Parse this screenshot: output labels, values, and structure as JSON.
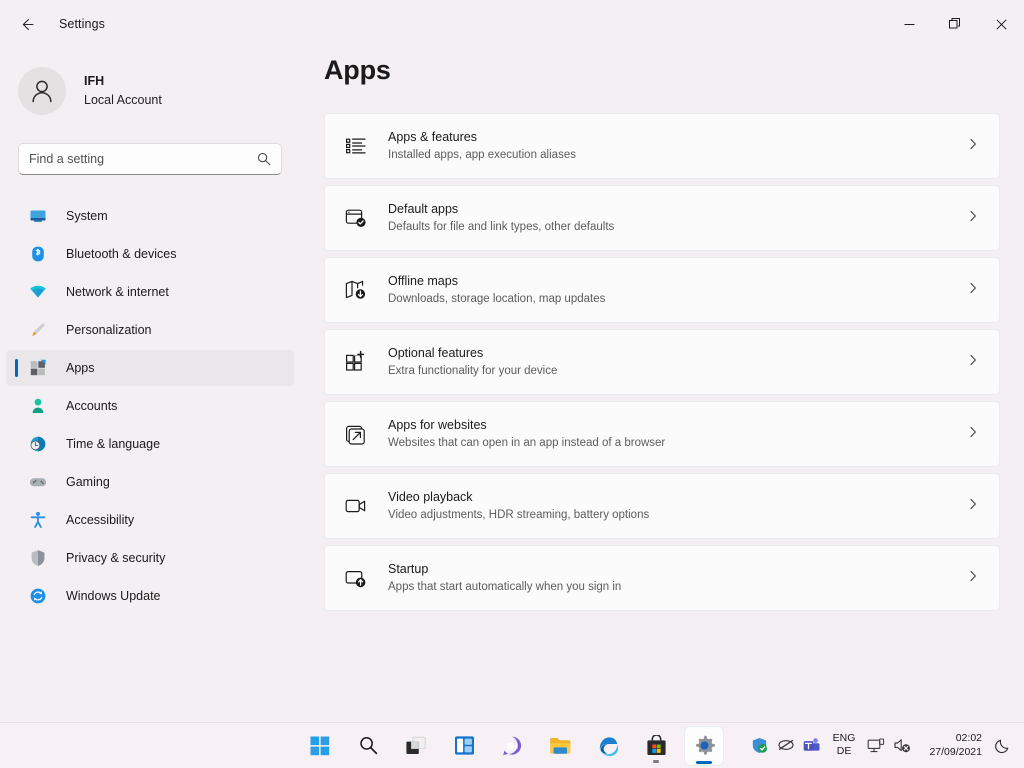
{
  "window": {
    "title": "Settings",
    "back_label": "back-arrow",
    "minimize_label": "Minimize",
    "maximize_label": "Restore",
    "close_label": "Close"
  },
  "account": {
    "name": "IFH",
    "type": "Local Account"
  },
  "search": {
    "placeholder": "Find a setting",
    "value": ""
  },
  "sidebar": {
    "items": [
      {
        "label": "System",
        "icon": "system-icon",
        "selected": false
      },
      {
        "label": "Bluetooth & devices",
        "icon": "bluetooth-icon",
        "selected": false
      },
      {
        "label": "Network & internet",
        "icon": "network-icon",
        "selected": false
      },
      {
        "label": "Personalization",
        "icon": "personalization-icon",
        "selected": false
      },
      {
        "label": "Apps",
        "icon": "apps-icon",
        "selected": true
      },
      {
        "label": "Accounts",
        "icon": "accounts-icon",
        "selected": false
      },
      {
        "label": "Time & language",
        "icon": "time-language-icon",
        "selected": false
      },
      {
        "label": "Gaming",
        "icon": "gaming-icon",
        "selected": false
      },
      {
        "label": "Accessibility",
        "icon": "accessibility-icon",
        "selected": false
      },
      {
        "label": "Privacy & security",
        "icon": "privacy-security-icon",
        "selected": false
      },
      {
        "label": "Windows Update",
        "icon": "windows-update-icon",
        "selected": false
      }
    ]
  },
  "main": {
    "title": "Apps",
    "cards": [
      {
        "title": "Apps & features",
        "subtitle": "Installed apps, app execution aliases",
        "icon": "apps-features-icon"
      },
      {
        "title": "Default apps",
        "subtitle": "Defaults for file and link types, other defaults",
        "icon": "default-apps-icon"
      },
      {
        "title": "Offline maps",
        "subtitle": "Downloads, storage location, map updates",
        "icon": "offline-maps-icon"
      },
      {
        "title": "Optional features",
        "subtitle": "Extra functionality for your device",
        "icon": "optional-features-icon"
      },
      {
        "title": "Apps for websites",
        "subtitle": "Websites that can open in an app instead of a browser",
        "icon": "apps-for-websites-icon"
      },
      {
        "title": "Video playback",
        "subtitle": "Video adjustments, HDR streaming, battery options",
        "icon": "video-playback-icon"
      },
      {
        "title": "Startup",
        "subtitle": "Apps that start automatically when you sign in",
        "icon": "startup-icon"
      }
    ]
  },
  "taskbar": {
    "buttons": [
      {
        "name": "start-button",
        "label": "Start"
      },
      {
        "name": "search-button",
        "label": "Search"
      },
      {
        "name": "task-view-button",
        "label": "Task view"
      },
      {
        "name": "widgets-button",
        "label": "Widgets"
      },
      {
        "name": "chat-button",
        "label": "Chat"
      },
      {
        "name": "file-explorer-button",
        "label": "File Explorer"
      },
      {
        "name": "edge-button",
        "label": "Microsoft Edge"
      },
      {
        "name": "microsoft-store-button",
        "label": "Microsoft Store"
      },
      {
        "name": "settings-button",
        "label": "Settings"
      }
    ],
    "tray": {
      "defender_label": "Windows Security",
      "hidden_label": "Hidden icons",
      "teams_label": "Microsoft Teams",
      "language_primary": "ENG",
      "language_secondary": "DE",
      "network_label": "Network",
      "volume_label": "Volume muted",
      "time": "02:02",
      "date": "27/09/2021",
      "notifications_label": "Notifications"
    }
  },
  "colors": {
    "page_bg": "#f3eff2",
    "card_bg": "#fbfbfb",
    "accent": "#0067c0",
    "selected_nav_bg": "#e9e7e9",
    "taskbar_bg": "#f7f1f5"
  }
}
